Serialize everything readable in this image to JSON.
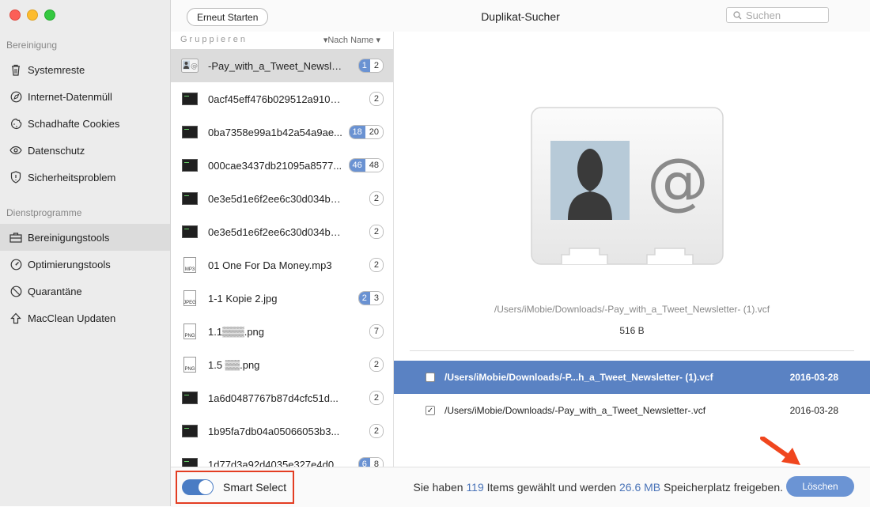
{
  "window": {
    "title": "Duplikat-Sucher",
    "restart_label": "Erneut Starten",
    "search_placeholder": "Suchen"
  },
  "sidebar": {
    "section1": "Bereinigung",
    "section2": "Dienstprogramme",
    "items": [
      {
        "label": "Systemreste",
        "icon": "trash-icon"
      },
      {
        "label": "Internet-Datenmüll",
        "icon": "compass-icon"
      },
      {
        "label": "Schadhafte Cookies",
        "icon": "cookie-icon"
      },
      {
        "label": "Datenschutz",
        "icon": "eye-icon"
      },
      {
        "label": "Sicherheitsproblem",
        "icon": "shield-icon"
      },
      {
        "label": "Bereinigungstools",
        "icon": "toolbox-icon"
      },
      {
        "label": "Optimierungstools",
        "icon": "gauge-icon"
      },
      {
        "label": "Quarantäne",
        "icon": "quarantine-icon"
      },
      {
        "label": "MacClean Updaten",
        "icon": "upload-arrow-icon"
      }
    ],
    "active_item": "Bereinigungstools"
  },
  "list": {
    "group_label": "Gruppieren",
    "sort_label": "Nach Name",
    "rows": [
      {
        "name": "-Pay_with_a_Tweet_Newsle...",
        "icon": "contact-card-icon",
        "selected": "1",
        "total": "2"
      },
      {
        "name": "0acf45eff476b029512a910c...",
        "icon": "terminal-icon",
        "selected": "",
        "total": "2"
      },
      {
        "name": "0ba7358e99a1b42a54a9ae...",
        "icon": "terminal-icon",
        "selected": "18",
        "total": "20"
      },
      {
        "name": "000cae3437db21095a8577...",
        "icon": "terminal-icon",
        "selected": "46",
        "total": "48"
      },
      {
        "name": "0e3e5d1e6f2ee6c30d034b1...",
        "icon": "terminal-icon",
        "selected": "",
        "total": "2"
      },
      {
        "name": "0e3e5d1e6f2ee6c30d034b1...",
        "icon": "terminal-icon",
        "selected": "",
        "total": "2"
      },
      {
        "name": "01 One For Da Money.mp3",
        "icon": "mp3-file-icon",
        "selected": "",
        "total": "2"
      },
      {
        "name": "1-1 Kopie 2.jpg",
        "icon": "jpeg-file-icon",
        "selected": "2",
        "total": "3"
      },
      {
        "name": "1.1▒▒▒.png",
        "icon": "png-file-icon",
        "selected": "",
        "total": "7"
      },
      {
        "name": "1.5 ▒▒.png",
        "icon": "png-file-icon",
        "selected": "",
        "total": "2"
      },
      {
        "name": "1a6d0487767b87d4cfc51d...",
        "icon": "terminal-icon",
        "selected": "",
        "total": "2"
      },
      {
        "name": "1b95fa7db04a05066053b3...",
        "icon": "terminal-icon",
        "selected": "",
        "total": "2"
      },
      {
        "name": "1d77d3a92d4035e327e4d0...",
        "icon": "terminal-icon",
        "selected": "6",
        "total": "8"
      }
    ]
  },
  "detail": {
    "preview_icon": "contact-card-icon",
    "path": "/Users/iMobie/Downloads/-Pay_with_a_Tweet_Newsletter- (1).vcf",
    "size": "516 B",
    "files": [
      {
        "path": "/Users/iMobie/Downloads/-P...h_a_Tweet_Newsletter- (1).vcf",
        "date": "2016-03-28",
        "checked": false,
        "highlighted": true
      },
      {
        "path": "/Users/iMobie/Downloads/-Pay_with_a_Tweet_Newsletter-.vcf",
        "date": "2016-03-28",
        "checked": true,
        "highlighted": false
      }
    ]
  },
  "bottom": {
    "smart_select_label": "Smart Select",
    "smart_select_on": true,
    "status_prefix": "Sie haben ",
    "items_count": "119",
    "status_mid": " Items gewählt und werden ",
    "size_freed": "26.6 MB",
    "status_suffix": " Speicherplatz freigeben.",
    "delete_label": "Löschen"
  },
  "colors": {
    "accent": "#5a82c3",
    "highlight_border": "#e33d22",
    "arrow": "#f0461e"
  }
}
